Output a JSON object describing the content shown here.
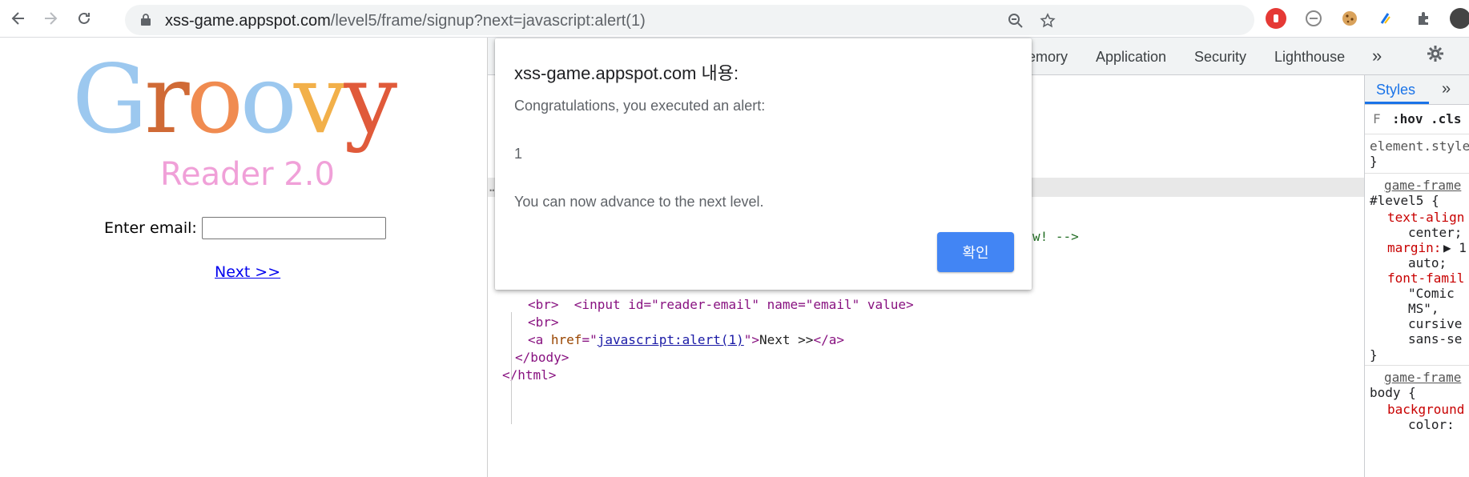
{
  "browser": {
    "url_host": "xss-game.appspot.com",
    "url_path": "/level5/frame/signup?next=javascript:alert(1)"
  },
  "page": {
    "logo_text": "Groovy",
    "logo_subtext": "Reader 2.0",
    "email_label": "Enter email:",
    "email_value": "",
    "next_link": "Next >>"
  },
  "devtools": {
    "tabs": [
      "emory",
      "Application",
      "Security",
      "Lighthouse"
    ],
    "more": "»",
    "code": {
      "comment_tail": "w! -->",
      "input_line": "<input id=\"reader-email\" name=\"email\" value>",
      "br1": "<br>",
      "br2": "<br>",
      "a_open": "<a ",
      "a_attr": "href",
      "a_eq": "=\"",
      "a_href": "javascript:alert(1)",
      "a_close_q": "\">",
      "a_text": "Next >>",
      "a_end": "</a>",
      "body_end": "</body>",
      "html_end": "</html>",
      "row_marker": "…"
    },
    "styles": {
      "tab": "Styles",
      "more": "»",
      "filter": "F",
      "hov": ":hov",
      "cls": ".cls",
      "element_style": "element.style",
      "close1": "}",
      "source1": "game-frame",
      "selector1": "#level5 {",
      "p1": "text-align",
      "v1": "center;",
      "p2": "margin:",
      "v2a": "▶ 1",
      "v2b": "auto;",
      "p3": "font-famil",
      "v3a": "\"Comic",
      "v3b": "MS\",",
      "v3c": "cursive",
      "v3d": "sans-se",
      "close2": "}",
      "source2": "game-frame",
      "selector2": "body {",
      "p4": "background",
      "v4": "color:"
    }
  },
  "dialog": {
    "title": "xss-game.appspot.com 내용:",
    "line1": "Congratulations, you executed an alert:",
    "line2": "1",
    "line3": "You can now advance to the next level.",
    "ok": "확인"
  },
  "colors": {
    "accent": "#4285f4",
    "logo_g": "#9cc8ef",
    "logo_r": "#d06a36",
    "logo_o1": "#f08b50",
    "logo_o2": "#9cc8ef",
    "logo_v": "#f2b04a",
    "logo_y": "#e05a3a",
    "logo_sub": "#f0a0d8"
  }
}
